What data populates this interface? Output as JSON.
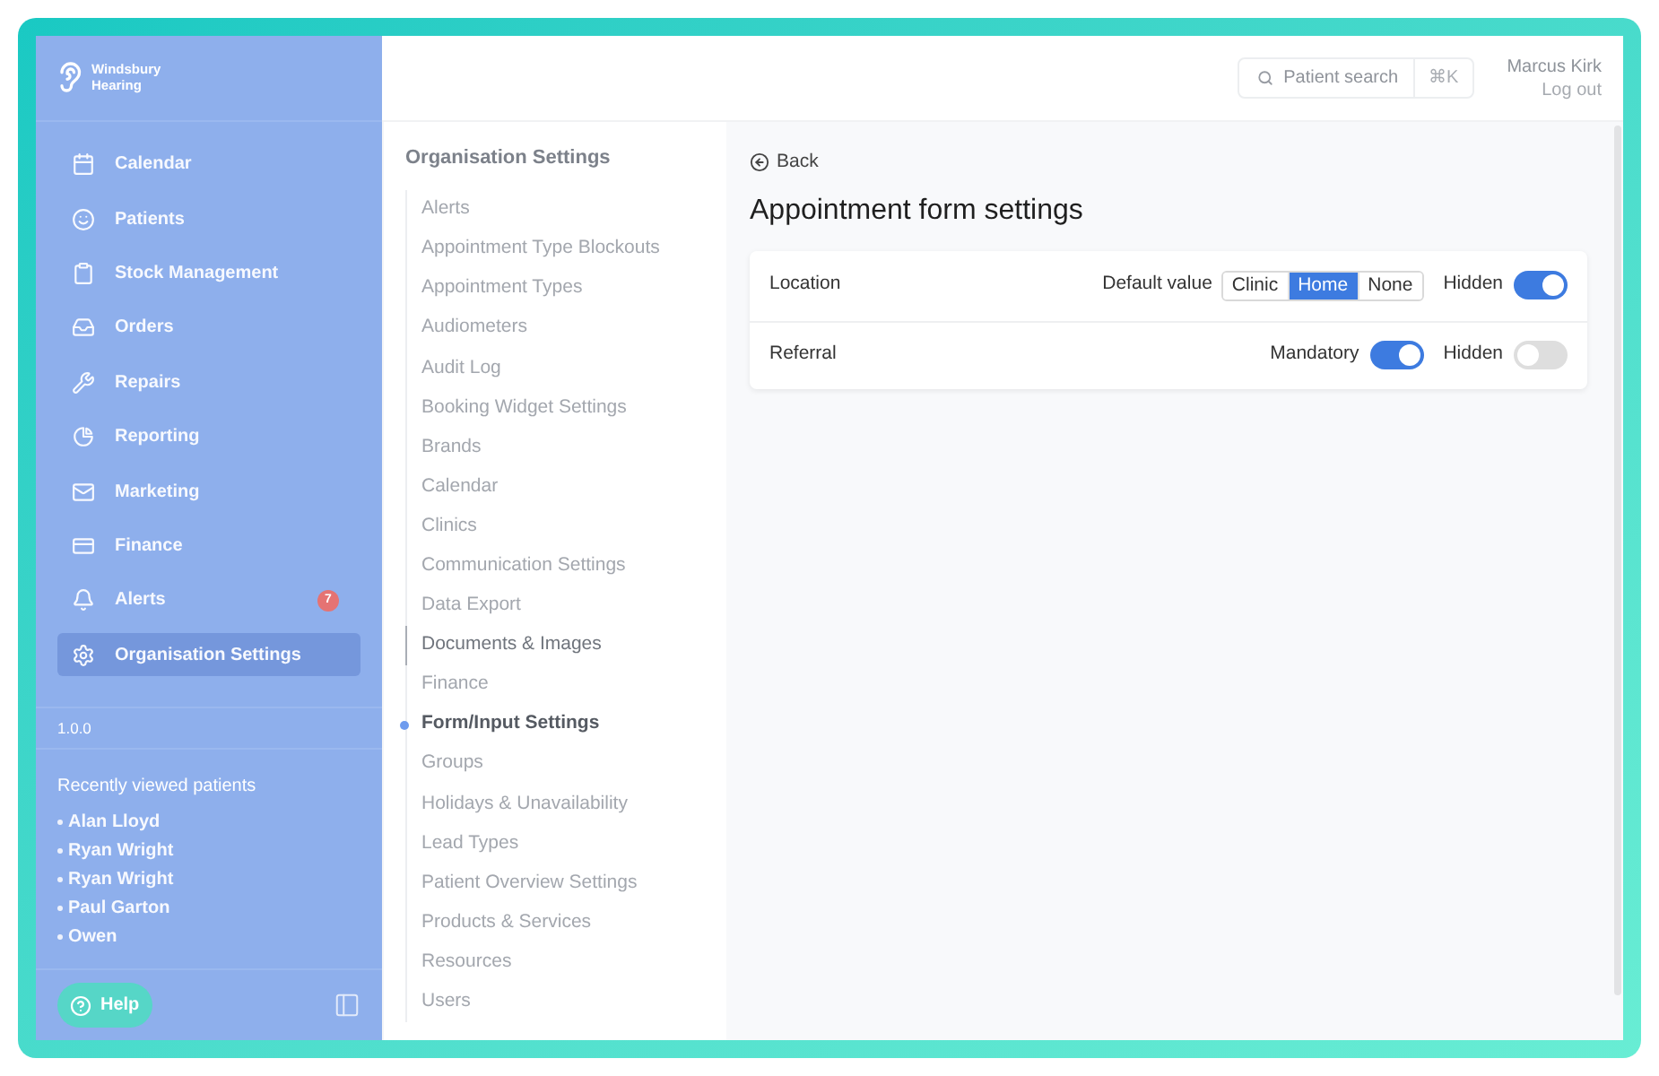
{
  "sidebar": {
    "logo": {
      "lines": [
        "Windsbury",
        "Hearing"
      ]
    },
    "nav": [
      {
        "label": "Calendar",
        "selected": false
      },
      {
        "label": "Patients",
        "selected": false
      },
      {
        "label": "Stock Management",
        "selected": false
      },
      {
        "label": "Orders",
        "selected": false
      },
      {
        "label": "Repairs",
        "selected": false
      },
      {
        "label": "Reporting",
        "selected": false
      },
      {
        "label": "Marketing",
        "selected": false
      },
      {
        "label": "Finance",
        "selected": false
      },
      {
        "label": "Alerts",
        "selected": false,
        "badge": "7"
      },
      {
        "label": "Organisation Settings",
        "selected": true
      }
    ],
    "version": "1.0.0",
    "recent": {
      "title": "Recently viewed patients",
      "patients": [
        "Alan Lloyd",
        "Ryan Wright",
        "Ryan Wright",
        "Paul Garton",
        "Owen"
      ]
    },
    "help": "Help"
  },
  "topbar": {
    "search": {
      "label": "Patient search",
      "shortcut": "⌘K"
    },
    "user": {
      "name": "Marcus Kirk",
      "logout": "Log out"
    }
  },
  "settings_nav": {
    "title": "Organisation Settings",
    "items": [
      {
        "label": "Alerts",
        "selected": false,
        "hovered": false
      },
      {
        "label": "Appointment Type Blockouts",
        "selected": false,
        "hovered": false
      },
      {
        "label": "Appointment Types",
        "selected": false,
        "hovered": false
      },
      {
        "label": "Audiometers",
        "selected": false,
        "hovered": false
      },
      {
        "label": "Audit Log",
        "selected": false,
        "hovered": false
      },
      {
        "label": "Booking Widget Settings",
        "selected": false,
        "hovered": false
      },
      {
        "label": "Brands",
        "selected": false,
        "hovered": false
      },
      {
        "label": "Calendar",
        "selected": false,
        "hovered": false
      },
      {
        "label": "Clinics",
        "selected": false,
        "hovered": false
      },
      {
        "label": "Communication Settings",
        "selected": false,
        "hovered": false
      },
      {
        "label": "Data Export",
        "selected": false,
        "hovered": false
      },
      {
        "label": "Documents & Images",
        "selected": false,
        "hovered": true
      },
      {
        "label": "Finance",
        "selected": false,
        "hovered": false
      },
      {
        "label": "Form/Input Settings",
        "selected": true,
        "hovered": false
      },
      {
        "label": "Groups",
        "selected": false,
        "hovered": false
      },
      {
        "label": "Holidays & Unavailability",
        "selected": false,
        "hovered": false
      },
      {
        "label": "Lead Types",
        "selected": false,
        "hovered": false
      },
      {
        "label": "Patient Overview Settings",
        "selected": false,
        "hovered": false
      },
      {
        "label": "Products & Services",
        "selected": false,
        "hovered": false
      },
      {
        "label": "Resources",
        "selected": false,
        "hovered": false
      },
      {
        "label": "Users",
        "selected": false,
        "hovered": false
      }
    ]
  },
  "page": {
    "back": "Back",
    "title": "Appointment form settings",
    "fields": [
      {
        "label": "Location",
        "controls": [
          {
            "kind": "segmented",
            "label": "Default value",
            "options": [
              {
                "label": "Clinic",
                "selected": false
              },
              {
                "label": "Home",
                "selected": true
              },
              {
                "label": "None",
                "selected": false
              }
            ]
          },
          {
            "kind": "toggle",
            "label": "Hidden",
            "on": true
          }
        ]
      },
      {
        "label": "Referral",
        "controls": [
          {
            "kind": "toggle",
            "label": "Mandatory",
            "on": true
          },
          {
            "kind": "toggle",
            "label": "Hidden",
            "on": false
          }
        ]
      }
    ]
  }
}
